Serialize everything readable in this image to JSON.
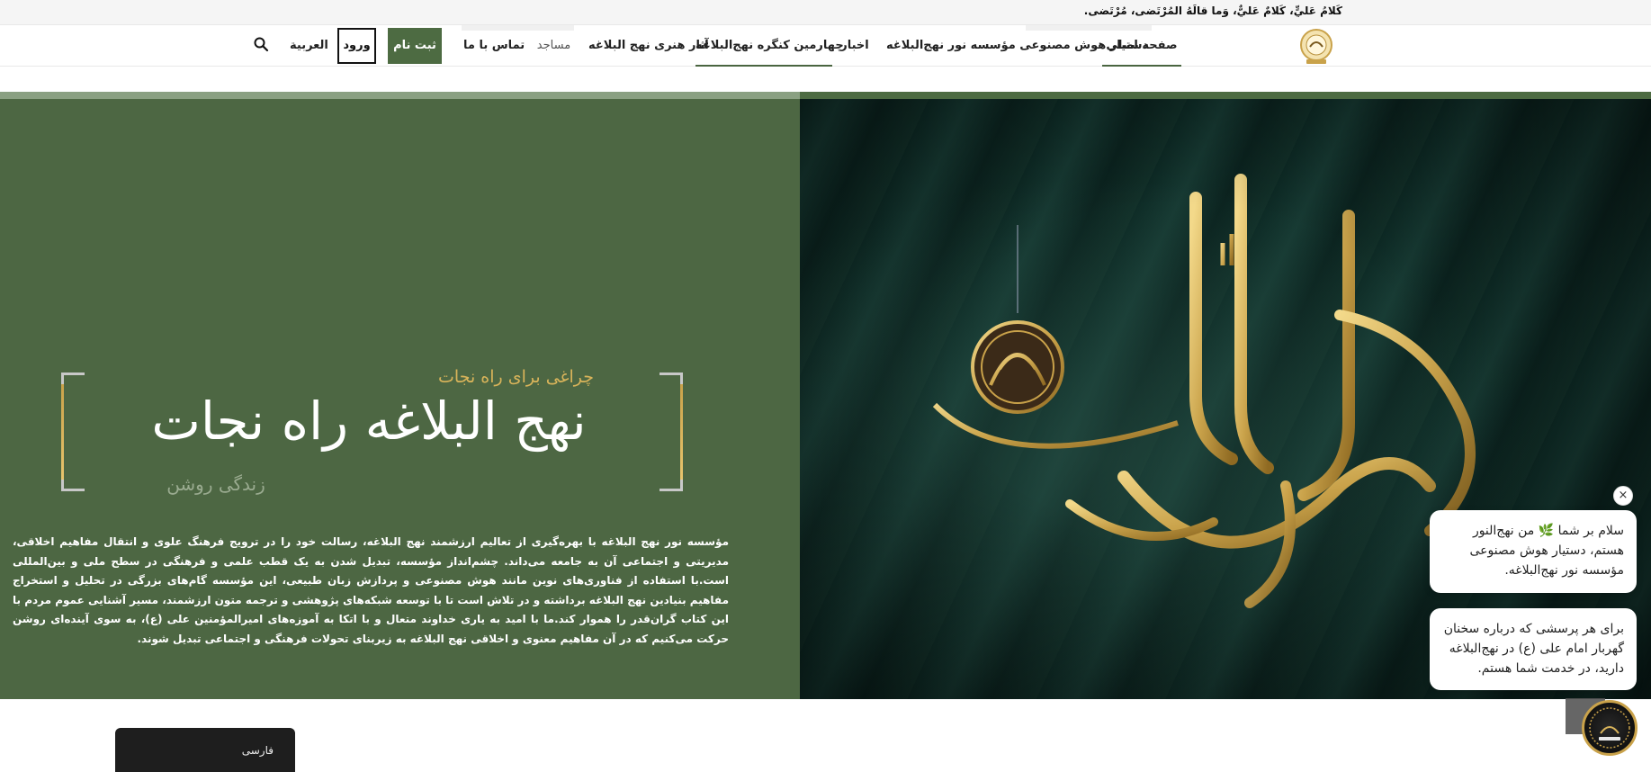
{
  "topbar": {
    "quote": "كَلامُ عَليٍّ، كَلامٌ عَليٌّ، وَما قالَهُ المُرْتَضى، مُرْتَضى."
  },
  "nav": {
    "logo_alt": "Noor Nahj al-Balagha logo",
    "items": [
      {
        "label": "صفحه اصلی",
        "active": true
      },
      {
        "label": "دستیار هوش مصنوعی مؤسسه نور نهج‌البلاغه",
        "active": false
      },
      {
        "label": "اخبار",
        "active": false
      },
      {
        "label": "چهارمین کنگره نهج‌البلاغه",
        "active": true
      },
      {
        "label": "آثار هنری نهج البلاغه",
        "active": false
      },
      {
        "label": "مساجد",
        "active": false
      },
      {
        "label": "تماس با ما",
        "active": false
      }
    ],
    "signup_label": "ثبت نام",
    "login_label": "ورود",
    "lang_label": "العربية",
    "search_icon": "search-icon",
    "accent_color": "#4d6b42"
  },
  "hero": {
    "subtitle": "چراغی برای راه نجات",
    "title": "نهج البلاغه راه نجات",
    "tagline": "زندگی روشن",
    "body": "مؤسسه نور نهج البلاغه با بهره‌گیری از تعالیم ارزشمند نهج البلاغه، رسالت خود را در ترویج فرهنگ علوی و انتقال مفاهیم اخلاقی، مدیریتی و اجتماعی آن به جامعه می‌داند. چشم‌انداز مؤسسه، تبدیل شدن به یک قطب علمی و فرهنگی در سطح ملی و بین‌المللی است.با استفاده از فناوری‌های نوین مانند هوش مصنوعی و پردازش زبان طبیعی، این مؤسسه گام‌های بزرگی در تحلیل و استخراج مفاهیم بنیادین نهج البلاغه برداشته و در تلاش است تا با توسعه شبکه‌های پژوهشی و ترجمه متون ارزشمند، مسیر آشنایی عموم مردم با این کتاب گران‌قدر را هموار کند.ما با امید به یاری خداوند متعال و با اتکا به آموزه‌های امیرالمؤمنین علی (ع)، به سوی آینده‌ای روشن حرکت می‌کنیم که در آن مفاهیم معنوی و اخلاقی نهج البلاغه به زیربنای تحولات فرهنگی و اجتماعی تبدیل شوند.",
    "left_bg": "#4d6743",
    "gold": "#d9b45a"
  },
  "chat": {
    "close_label": "×",
    "bubble1": "سلام بر شما 🌿 من نهج‌النور هستم، دستیار هوش مصنوعی مؤسسه نور نهج‌البلاغه.",
    "bubble2": "برای هر پرسشی که درباره سخنان گهربار امام علی (ع) در نهج‌البلاغه دارید، در خدمت شما هستم."
  },
  "lang_popup": {
    "label": "فارسی"
  }
}
